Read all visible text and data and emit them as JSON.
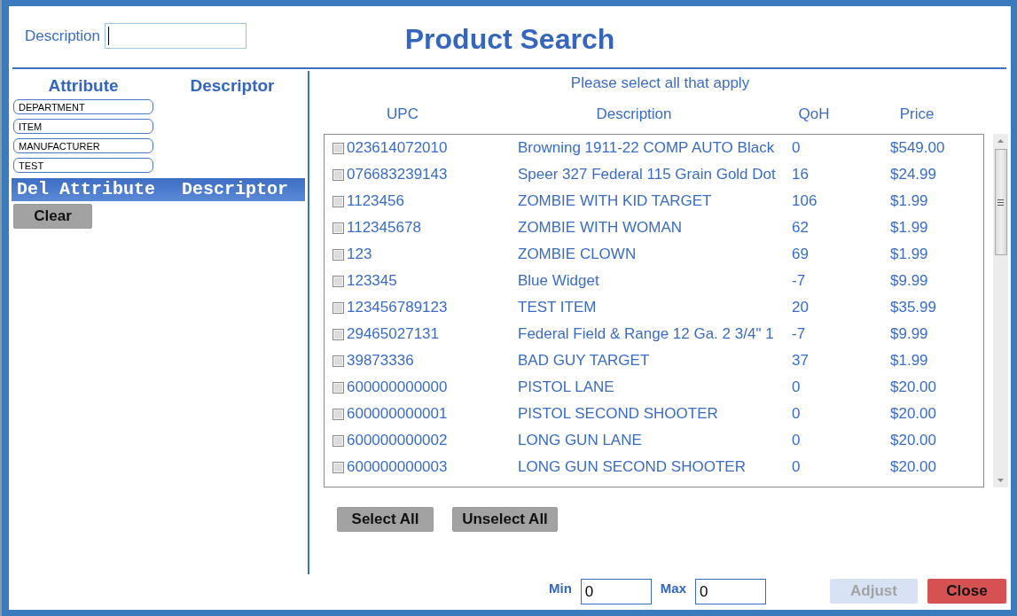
{
  "header": {
    "description_field": {
      "label": "Description",
      "focused": true
    },
    "title": "Product Search"
  },
  "attributes": {
    "columns": [
      "Attribute",
      "Descriptor"
    ],
    "items": [
      {
        "label": "DEPARTMENT"
      },
      {
        "label": "ITEM"
      },
      {
        "label": "MANUFACTURER"
      },
      {
        "label": "TEST"
      }
    ],
    "grid_columns": [
      "Del",
      "Attribute",
      "Descriptor"
    ],
    "clear_button": "Clear"
  },
  "products": {
    "instruction": "Please select all that apply",
    "columns": [
      "UPC",
      "Description",
      "QoH",
      "Price"
    ],
    "rows": [
      {
        "upc": "023614072010",
        "description": "Browning 1911-22 COMP AUTO Black",
        "qoh": "0",
        "price": "$549.00",
        "checked": false
      },
      {
        "upc": "076683239143",
        "description": "Speer 327 Federal 115 Grain Gold Dot",
        "qoh": "16",
        "price": "$24.99",
        "checked": false
      },
      {
        "upc": "1123456",
        "description": "ZOMBIE WITH KID TARGET",
        "qoh": "106",
        "price": "$1.99",
        "checked": false
      },
      {
        "upc": "112345678",
        "description": "ZOMBIE WITH WOMAN",
        "qoh": "62",
        "price": "$1.99",
        "checked": false
      },
      {
        "upc": "123",
        "description": "ZOMBIE CLOWN",
        "qoh": "69",
        "price": "$1.99",
        "checked": false
      },
      {
        "upc": "123345",
        "description": "Blue Widget",
        "qoh": "-7",
        "price": "$9.99",
        "checked": false
      },
      {
        "upc": "123456789123",
        "description": "TEST ITEM",
        "qoh": "20",
        "price": "$35.99",
        "checked": false
      },
      {
        "upc": "29465027131",
        "description": "Federal Field & Range 12 Ga. 2 3/4\" 1",
        "qoh": "-7",
        "price": "$9.99",
        "checked": false
      },
      {
        "upc": "39873336",
        "description": "BAD GUY TARGET",
        "qoh": "37",
        "price": "$1.99",
        "checked": false
      },
      {
        "upc": "600000000000",
        "description": "PISTOL LANE",
        "qoh": "0",
        "price": "$20.00",
        "checked": false
      },
      {
        "upc": "600000000001",
        "description": "PISTOL SECOND SHOOTER",
        "qoh": "0",
        "price": "$20.00",
        "checked": false
      },
      {
        "upc": "600000000002",
        "description": "LONG GUN LANE",
        "qoh": "0",
        "price": "$20.00",
        "checked": false
      },
      {
        "upc": "600000000003",
        "description": "LONG GUN SECOND SHOOTER",
        "qoh": "0",
        "price": "$20.00",
        "checked": false
      }
    ],
    "buttons": [
      {
        "label": "Select All"
      },
      {
        "label": "Unselect All"
      }
    ]
  },
  "footer": {
    "min": {
      "label": "Min",
      "value": "0"
    },
    "max": {
      "label": "Max",
      "value": "0"
    },
    "buttons": [
      {
        "label": "Adjust",
        "kind": "adjust",
        "disabled": true
      },
      {
        "label": "Close",
        "kind": "close",
        "disabled": false
      }
    ]
  }
}
